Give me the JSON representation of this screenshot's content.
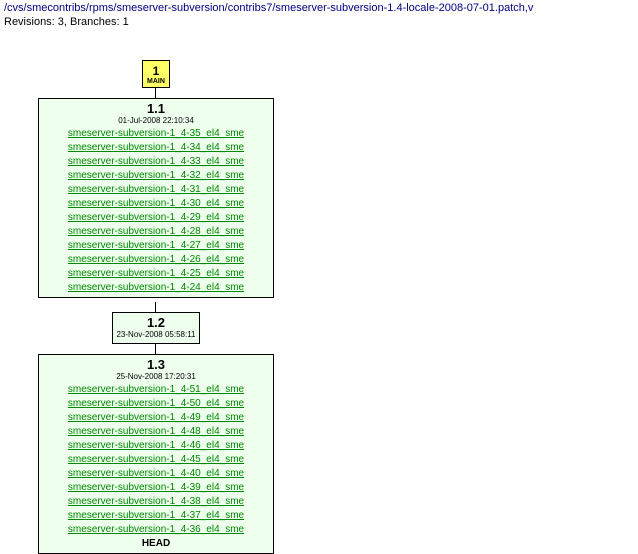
{
  "header": {
    "path": "/cvs/smecontribs/rpms/smeserver-subversion/contribs7/smeserver-subversion-1.4-locale-2008-07-01.patch,v",
    "stats": "Revisions: 3, Branches: 1"
  },
  "main": {
    "number": "1",
    "label": "MAIN"
  },
  "revisions": [
    {
      "version": "1.1",
      "date": "01-Jul-2008 22:10:34",
      "tags": [
        "smeserver-subversion-1_4-35_el4_sme",
        "smeserver-subversion-1_4-34_el4_sme",
        "smeserver-subversion-1_4-33_el4_sme",
        "smeserver-subversion-1_4-32_el4_sme",
        "smeserver-subversion-1_4-31_el4_sme",
        "smeserver-subversion-1_4-30_el4_sme",
        "smeserver-subversion-1_4-29_el4_sme",
        "smeserver-subversion-1_4-28_el4_sme",
        "smeserver-subversion-1_4-27_el4_sme",
        "smeserver-subversion-1_4-26_el4_sme",
        "smeserver-subversion-1_4-25_el4_sme",
        "smeserver-subversion-1_4-24_el4_sme"
      ],
      "head": ""
    },
    {
      "version": "1.2",
      "date": "23-Nov-2008 05:58:11",
      "tags": [],
      "head": ""
    },
    {
      "version": "1.3",
      "date": "25-Nov-2008 17:20:31",
      "tags": [
        "smeserver-subversion-1_4-51_el4_sme",
        "smeserver-subversion-1_4-50_el4_sme",
        "smeserver-subversion-1_4-49_el4_sme",
        "smeserver-subversion-1_4-48_el4_sme",
        "smeserver-subversion-1_4-46_el4_sme",
        "smeserver-subversion-1_4-45_el4_sme",
        "smeserver-subversion-1_4-40_el4_sme",
        "smeserver-subversion-1_4-39_el4_sme",
        "smeserver-subversion-1_4-38_el4_sme",
        "smeserver-subversion-1_4-37_el4_sme",
        "smeserver-subversion-1_4-36_el4_sme"
      ],
      "head": "HEAD"
    }
  ]
}
